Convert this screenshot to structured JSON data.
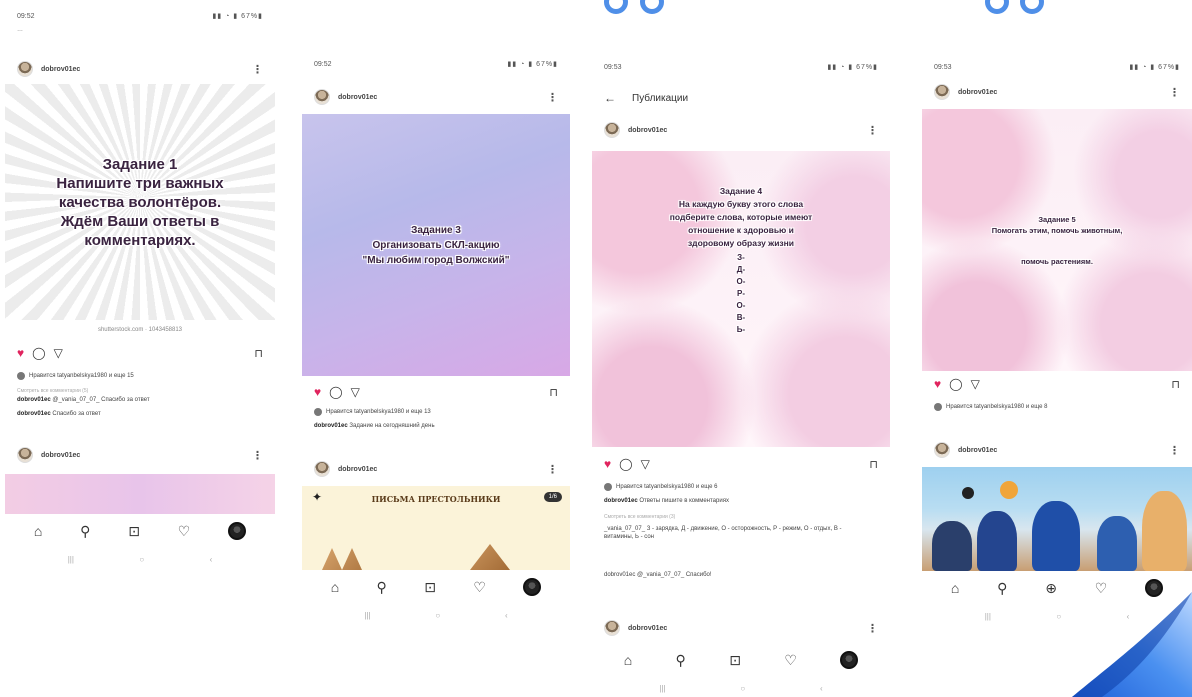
{
  "phones": [
    {
      "status_time": "09:52",
      "top_caption": "…",
      "username": "dobrov01ec",
      "post_lines": [
        "Задание 1",
        "Напишите три важных",
        "качества волонтёров.",
        "Ждём Ваши ответы в",
        "комментариях."
      ],
      "watermark": "shutterstock.com · 1043458813",
      "likes": "Нравится tatyanbelskya1980 и еще 15",
      "comments_link": "Смотреть все комментарии (5)",
      "comment1_user": "dobrov01ec",
      "comment1": "@_vania_07_07_ Спасибо за ответ",
      "comment2_user": "dobrov01ec",
      "comment2": "Спасибо за ответ",
      "second_username": "dobrov01ec"
    },
    {
      "status_time": "09:52",
      "username": "dobrov01ec",
      "post_lines": [
        "Задание 3",
        "Организовать СКЛ-акцию",
        "\"Мы любим город Волжский\""
      ],
      "likes": "Нравится tatyanbelskya1980 и еще 13",
      "caption_user": "dobrov01ec",
      "caption": "Задание на сегодняшний день",
      "second_username": "dobrov01ec",
      "card_title": "ПИСЬМА ПРЕСТОЛЬНИКИ",
      "card_badge": "1/6"
    },
    {
      "status_time": "09:53",
      "screen_title": "Публикации",
      "username": "dobrov01ec",
      "post_lines": [
        "Задание 4",
        "На каждую букву этого слова",
        "подберите слова, которые имеют",
        "отношение к здоровью и",
        "здоровому образу жизни"
      ],
      "vertical_letters": [
        "З-",
        "Д-",
        "О-",
        "Р-",
        "О-",
        "В-",
        "Ь-"
      ],
      "likes": "Нравится tatyanbelskya1980 и еще 6",
      "caption_user": "dobrov01ec",
      "caption": "Ответы пишите в комментариях",
      "comments_link": "Смотреть все комментарии (3)",
      "comment1": "_vania_07_07_ З - зарядка, Д - движение, О - осторожность, Р - режим, О - отдых, В - витамины, Ь - сон",
      "comment2": "dobrov01ec @_vania_07_07_ Спасибо!",
      "second_username": "dobrov01ec"
    },
    {
      "status_time": "09:53",
      "username": "dobrov01ec",
      "post_lines": [
        "Задание 5",
        "Помогать этим, помочь животным,",
        "",
        "помочь растениям."
      ],
      "likes": "Нравится tatyanbelskya1980 и еще 8",
      "second_username": "dobrov01ec"
    }
  ],
  "colors": {
    "heart": "#e0245e",
    "accent_blue": "#4f8fe8"
  }
}
